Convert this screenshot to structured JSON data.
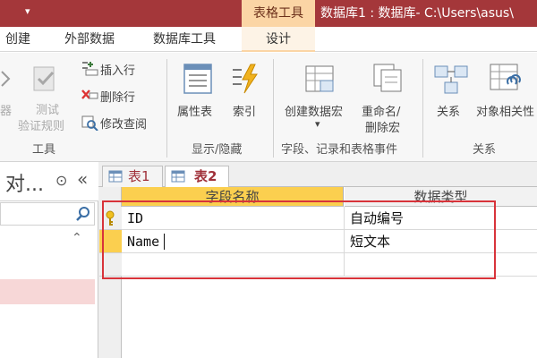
{
  "title_bar": {
    "context_group": "表格工具",
    "window_title": "数据库1 : 数据库- C:\\Users\\asus\\"
  },
  "tabs": {
    "create": "创建",
    "external": "外部数据",
    "db_tools": "数据库工具",
    "design": "设计"
  },
  "ribbon": {
    "tools_group": {
      "partial_left": "器",
      "test_rules_line1": "测试",
      "test_rules_line2": "验证规则",
      "insert_row": "插入行",
      "delete_row": "删除行",
      "modify_lookup": "修改查阅",
      "label": "工具"
    },
    "show_hide_group": {
      "property_sheet": "属性表",
      "indexes": "索引",
      "label": "显示/隐藏"
    },
    "events_group": {
      "create_macro": "创建数据宏",
      "create_macro_arrow": "▾",
      "rename_macro_line1": "重命名/",
      "rename_macro_line2": "删除宏",
      "label": "字段、记录和表格事件"
    },
    "relationships_group": {
      "relationships": "关系",
      "object_dependencies": "对象相关性",
      "label": "关系"
    }
  },
  "nav_pane": {
    "title": "对...",
    "dropdown_glyph": "⊙",
    "collapse_glyph": "«",
    "search_glyph": "⌕",
    "scroll_up_glyph": "⌃"
  },
  "doc_tabs": [
    {
      "label": "表1"
    },
    {
      "label": "表2"
    }
  ],
  "grid": {
    "columns": [
      "字段名称",
      "数据类型"
    ],
    "rows": [
      {
        "field": "ID",
        "type": "自动编号",
        "primary_key": true
      },
      {
        "field": "Name",
        "type": "短文本",
        "primary_key": false
      }
    ]
  },
  "colors": {
    "title_bar": "#a4373a",
    "context_tab": "#fbd5a5",
    "selected_header": "#fbcf4f",
    "highlight_box": "#d8333a"
  }
}
